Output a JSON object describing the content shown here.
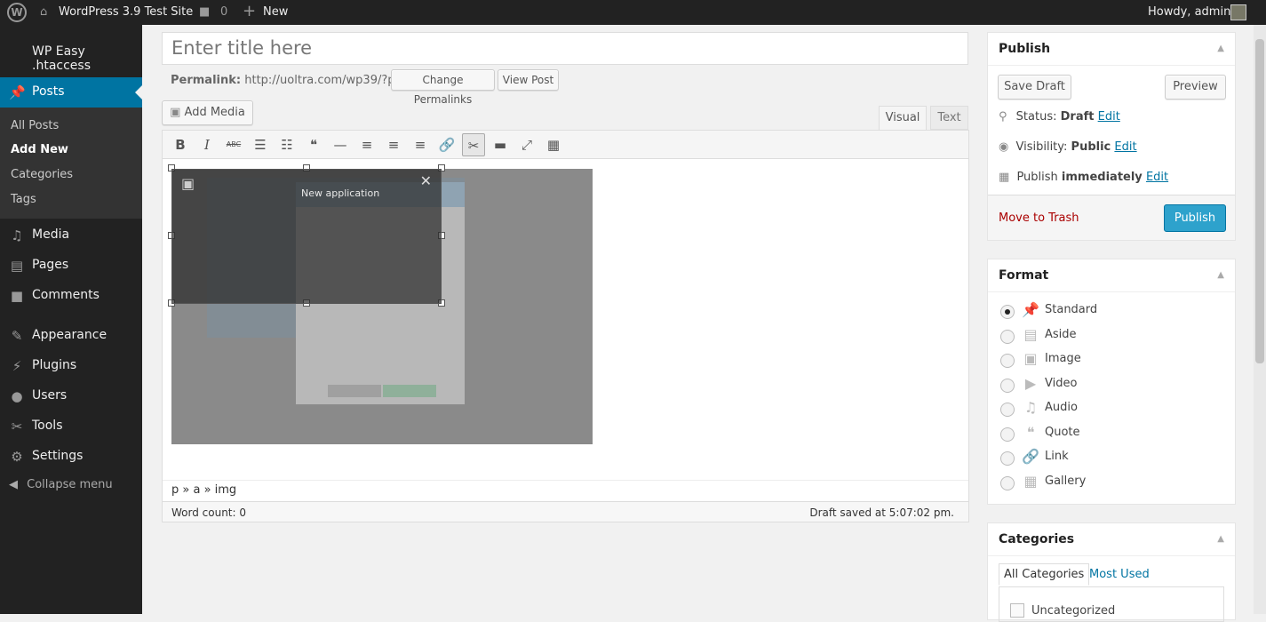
{
  "adminbar": {
    "site": "WordPress 3.9 Test Site",
    "comments": "0",
    "new": "New",
    "howdy": "Howdy, admin"
  },
  "sidebar": {
    "plugin": "WP Easy .htaccess",
    "posts": "Posts",
    "sub": [
      "All Posts",
      "Add New",
      "Categories",
      "Tags"
    ],
    "items": [
      {
        "icon": "media-icon",
        "glyph": "♫",
        "label": "Media"
      },
      {
        "icon": "pages-icon",
        "glyph": "▤",
        "label": "Pages"
      },
      {
        "icon": "comments-icon",
        "glyph": "■",
        "label": "Comments"
      },
      {
        "icon": "appearance-icon",
        "glyph": "✎",
        "label": "Appearance"
      },
      {
        "icon": "plugins-icon",
        "glyph": "⚡",
        "label": "Plugins"
      },
      {
        "icon": "users-icon",
        "glyph": "●",
        "label": "Users"
      },
      {
        "icon": "tools-icon",
        "glyph": "✂",
        "label": "Tools"
      },
      {
        "icon": "settings-icon",
        "glyph": "⚙",
        "label": "Settings"
      }
    ],
    "collapse": "Collapse menu"
  },
  "editor": {
    "title_placeholder": "Enter title here",
    "permalink_label": "Permalink:",
    "permalink_url": "http://uoltra.com/wp39/?p=7",
    "change_permalinks": "Change Permalinks",
    "view_post": "View Post",
    "add_media": "Add Media",
    "tab_visual": "Visual",
    "tab_text": "Text",
    "toolbar": [
      {
        "n": "bold",
        "g": "B"
      },
      {
        "n": "italic",
        "g": "I"
      },
      {
        "n": "strikethrough",
        "g": "ABC"
      },
      {
        "n": "bullet-list",
        "g": "☰"
      },
      {
        "n": "numbered-list",
        "g": "☷"
      },
      {
        "n": "blockquote",
        "g": "❝"
      },
      {
        "n": "horizontal-rule",
        "g": "—"
      },
      {
        "n": "align-left",
        "g": "≡"
      },
      {
        "n": "align-center",
        "g": "≡"
      },
      {
        "n": "align-right",
        "g": "≡"
      },
      {
        "n": "link",
        "g": "🔗"
      },
      {
        "n": "unlink",
        "g": "✂"
      },
      {
        "n": "more",
        "g": "▬"
      },
      {
        "n": "fullscreen",
        "g": "⤢"
      },
      {
        "n": "kitchen-sink",
        "g": "▦"
      }
    ],
    "path": "p » a » img",
    "word_count": "Word count: 0",
    "draft_saved": "Draft saved at 5:07:02 pm.",
    "image_dialog_title": "New application"
  },
  "publish": {
    "title": "Publish",
    "save_draft": "Save Draft",
    "preview": "Preview",
    "status_label": "Status:",
    "status": "Draft",
    "visibility_label": "Visibility:",
    "visibility": "Public",
    "publish_label": "Publish",
    "publish_when": "immediately",
    "edit": "Edit",
    "trash": "Move to Trash",
    "publish_btn": "Publish"
  },
  "format": {
    "title": "Format",
    "options": [
      {
        "label": "Standard",
        "icon": "pin-icon",
        "g": "📌",
        "checked": true
      },
      {
        "label": "Aside",
        "icon": "aside-icon",
        "g": "▤"
      },
      {
        "label": "Image",
        "icon": "image-icon",
        "g": "▣"
      },
      {
        "label": "Video",
        "icon": "video-icon",
        "g": "▶"
      },
      {
        "label": "Audio",
        "icon": "audio-icon",
        "g": "♫"
      },
      {
        "label": "Quote",
        "icon": "quote-icon",
        "g": "❝"
      },
      {
        "label": "Link",
        "icon": "link-icon",
        "g": "🔗"
      },
      {
        "label": "Gallery",
        "icon": "gallery-icon",
        "g": "▦"
      }
    ]
  },
  "categories": {
    "title": "Categories",
    "tab_all": "All Categories",
    "tab_used": "Most Used",
    "items": [
      "Uncategorized"
    ]
  }
}
